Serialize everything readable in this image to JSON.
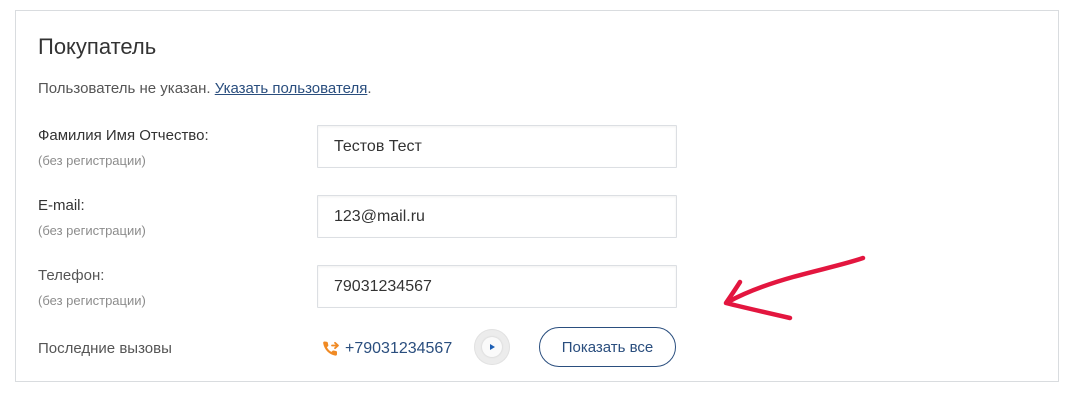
{
  "section": {
    "title": "Покупатель"
  },
  "user_notice": {
    "text": "Пользователь не указан. ",
    "link": "Указать пользователя",
    "suffix": "."
  },
  "fields": {
    "full_name": {
      "label": "Фамилия Имя Отчество:",
      "hint": "(без регистрации)",
      "value": "Тестов Тест"
    },
    "email": {
      "label": "E-mail:",
      "hint": "(без регистрации)",
      "value": "123@mail.ru"
    },
    "phone": {
      "label": "Телефон:",
      "hint": "(без регистрации)",
      "value": "79031234567"
    }
  },
  "recent_calls": {
    "label": "Последние вызовы",
    "number": "+79031234567",
    "show_all_label": "Показать все"
  },
  "icons": {
    "call": "phone-outgoing-icon",
    "play": "play-icon",
    "annotation": "red-arrow-annotation"
  },
  "colors": {
    "accent": "#2a4e7e",
    "call_icon": "#f08a24",
    "play_icon": "#1d5fb4",
    "annotation": "#e3163f"
  }
}
